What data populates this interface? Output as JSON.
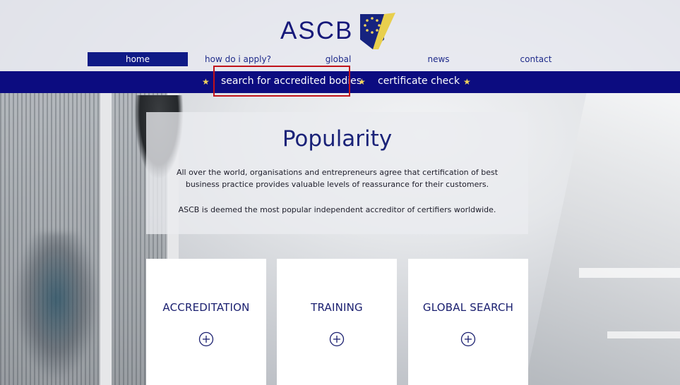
{
  "brand": {
    "logo_text": "ASCB",
    "colors": {
      "navy": "#0c0c80",
      "accent_star": "#f3d35b",
      "highlight": "#c0121a"
    }
  },
  "main_nav": {
    "items": [
      {
        "label": "home",
        "active": true
      },
      {
        "label": "how do i apply?"
      },
      {
        "label": "global"
      },
      {
        "label": "news"
      },
      {
        "label": "contact"
      }
    ]
  },
  "sub_nav": {
    "items": [
      {
        "label": "search for accredited bodies",
        "highlighted": true
      },
      {
        "label": "certificate check"
      }
    ],
    "separator_icon": "star-icon"
  },
  "hero": {
    "title": "Popularity",
    "paragraph1": "All over the world, organisations and entrepreneurs agree that certification of best business practice provides valuable levels of reassurance for their customers.",
    "paragraph2": "ASCB is deemed the most popular independent accreditor of certifiers worldwide."
  },
  "cards": [
    {
      "title": "ACCREDITATION",
      "icon": "plus-circle-icon"
    },
    {
      "title": "TRAINING",
      "icon": "plus-circle-icon"
    },
    {
      "title": "GLOBAL SEARCH",
      "icon": "plus-circle-icon"
    }
  ]
}
